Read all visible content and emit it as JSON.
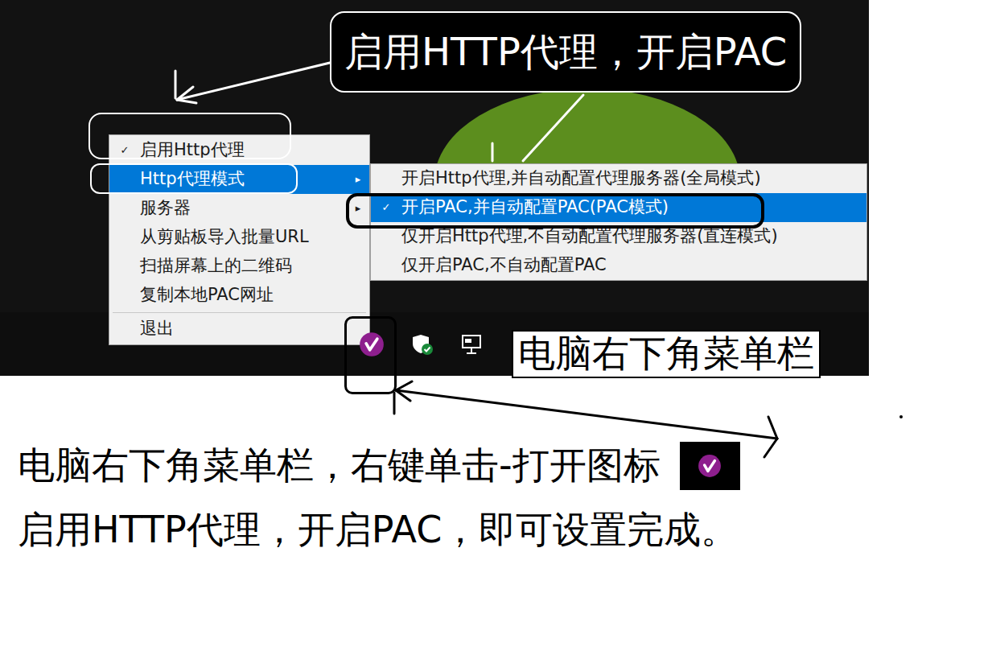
{
  "annotations": {
    "callout": "启用HTTP代理，开启PAC",
    "taskbar_label": "电脑右下角菜单栏",
    "instructions": [
      "电脑右下角菜单栏，右键单击-打开图标",
      "启用HTTP代理，开启PAC，即可设置完成。"
    ]
  },
  "glyphs": {
    "check": "✓",
    "submenu_arrow": "▸"
  },
  "context_menu": {
    "items": [
      {
        "kind": "item",
        "label": "启用Http代理",
        "checked": true,
        "selected": false,
        "submenu": false
      },
      {
        "kind": "item",
        "label": "Http代理模式",
        "checked": false,
        "selected": true,
        "submenu": true
      },
      {
        "kind": "item",
        "label": "服务器",
        "checked": false,
        "selected": false,
        "submenu": true
      },
      {
        "kind": "item",
        "label": "从剪贴板导入批量URL",
        "checked": false,
        "selected": false,
        "submenu": false
      },
      {
        "kind": "item",
        "label": "扫描屏幕上的二维码",
        "checked": false,
        "selected": false,
        "submenu": false
      },
      {
        "kind": "item",
        "label": "复制本地PAC网址",
        "checked": false,
        "selected": false,
        "submenu": false
      },
      {
        "kind": "separator"
      },
      {
        "kind": "item",
        "label": "退出",
        "checked": false,
        "selected": false,
        "submenu": false
      }
    ]
  },
  "submenu": {
    "items": [
      {
        "label": "开启Http代理,并自动配置代理服务器(全局模式)",
        "checked": false,
        "selected": false
      },
      {
        "label": "开启PAC,并自动配置PAC(PAC模式)",
        "checked": true,
        "selected": true
      },
      {
        "label": "仅开启Http代理,不自动配置代理服务器(直连模式)",
        "checked": false,
        "selected": false
      },
      {
        "label": "仅开启PAC,不自动配置PAC",
        "checked": false,
        "selected": false
      }
    ]
  }
}
